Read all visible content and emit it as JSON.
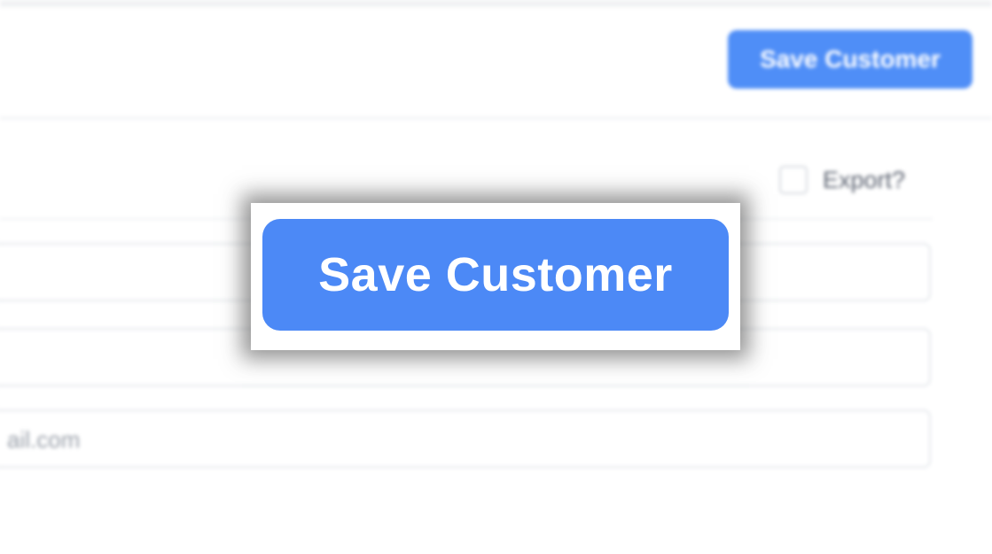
{
  "header": {
    "save_label": "Save Customer"
  },
  "form": {
    "export_checkbox_label": "Export?",
    "export_checked": false,
    "email_field_value": "ail.com"
  },
  "zoom_callout": {
    "save_label": "Save Customer"
  },
  "colors": {
    "accent": "#4c89f6",
    "background": "#ffffff",
    "border": "#e4e7ec"
  }
}
